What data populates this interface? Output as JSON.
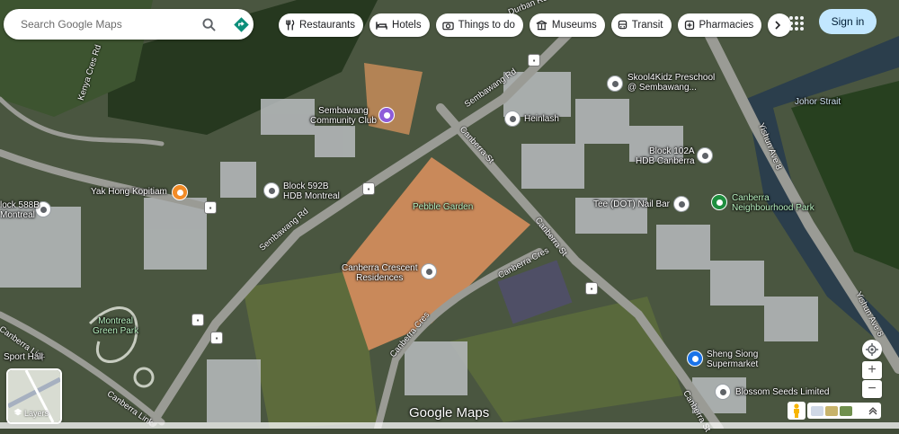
{
  "search": {
    "placeholder": "Search Google Maps"
  },
  "chips": [
    {
      "label": "Restaurants",
      "icon": "fork-knife-icon"
    },
    {
      "label": "Hotels",
      "icon": "bed-icon"
    },
    {
      "label": "Things to do",
      "icon": "camera-icon"
    },
    {
      "label": "Museums",
      "icon": "museum-icon"
    },
    {
      "label": "Transit",
      "icon": "bus-icon"
    },
    {
      "label": "Pharmacies",
      "icon": "pill-icon"
    }
  ],
  "header": {
    "signin": "Sign in"
  },
  "places": {
    "skool": "Skool4Kidz Preschool",
    "skool2": "@ Sembawang...",
    "community": "Sembawang",
    "community2": "Community Club",
    "heinlash": "Heinlash",
    "block102": "Block 102A",
    "block102b": "HDB Canberra",
    "block592": "Block 592B",
    "block592b": "HDB Montreal",
    "block588": "lock 588B",
    "block588b": "Montreal",
    "yakhong": "Yak Hong Kopitiam",
    "pebble": "Pebble Garden",
    "tee": "Tee (DOT) Nail Bar",
    "canberra_park": "Canberra",
    "canberra_park2": "Neighbourhood Park",
    "crescent": "Canberra Crescent",
    "crescent2": "Residences",
    "montreal_park": "Montreal",
    "montreal_park2": "Green Park",
    "sport": "Sport Hall",
    "shengsiong": "Sheng Siong",
    "shengsiong2": "Supermarket",
    "blossom": "Blossom Seeds Limited",
    "johor": "Johor Strait"
  },
  "roads": {
    "durban": "Durban Rd",
    "sembawang1": "Sembawang Rd",
    "sembawang2": "Sembawang Rd",
    "canberra_st1": "Canberra St",
    "canberra_st2": "Canberra St",
    "canberra_st3": "Canberra St",
    "canberra_cres1": "Canberra Cres",
    "canberra_cres2": "Canberra Cres",
    "canberra_link1": "Canberra Link",
    "canberra_link2": "Canberra Link",
    "kenya": "Kenya Cres Rd",
    "yishun1": "Yishun Ave 8",
    "yishun2": "Yishun Ave 8"
  },
  "controls": {
    "layers": "Layers",
    "logo": "Google Maps"
  },
  "colors": {
    "accent": "#c2e7ff",
    "water": "#2b3e4c",
    "sand": "#c9895a"
  }
}
